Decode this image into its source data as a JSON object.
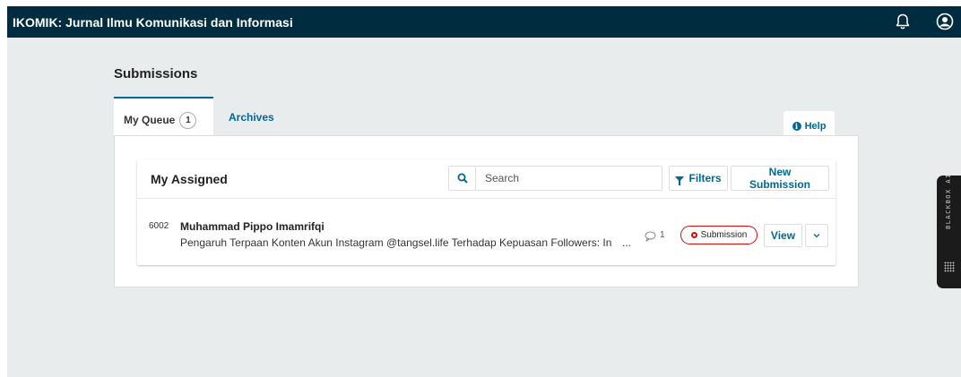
{
  "header": {
    "site_title": "IKOMIK: Jurnal Ilmu Komunikasi dan Informasi",
    "bell_icon": "bell-icon",
    "user_icon": "user-circle-icon"
  },
  "page": {
    "title": "Submissions"
  },
  "tabs": [
    {
      "label": "My Queue",
      "count": "1"
    },
    {
      "label": "Archives"
    }
  ],
  "help": {
    "label": "Help",
    "icon": "info-circle-icon"
  },
  "list": {
    "title": "My Assigned",
    "search": {
      "placeholder": "Search",
      "value": ""
    },
    "filters_label": "Filters",
    "new_submission_label": "New Submission",
    "rows": [
      {
        "id": "6002",
        "author": "Muhammad Pippo Imamrifqi",
        "title": "Pengaruh Terpaan Konten Akun Instagram @tangsel.life Terhadap Kepuasan Followers: In",
        "ellipsis": "...",
        "comments": "1",
        "status": "Submission",
        "view_label": "View"
      }
    ]
  },
  "extension": {
    "label": "BLACKBOX AI"
  },
  "colors": {
    "header_bg": "#002c40",
    "link": "#006798",
    "status_red": "#d00a0a",
    "page_bg": "#e9ecec"
  }
}
